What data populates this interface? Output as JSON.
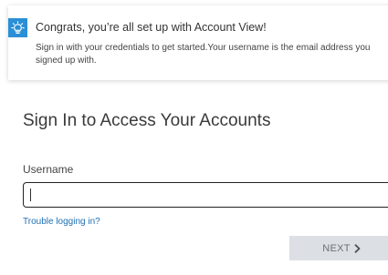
{
  "notice": {
    "icon": "lightbulb-icon",
    "title": "Congrats, you’re all set up with Account View!",
    "body": "Sign in with your credentials to get started.Your username is the email address you signed up with."
  },
  "signin": {
    "heading": "Sign In to Access Your Accounts",
    "username_label": "Username",
    "username_value": "",
    "trouble_link": "Trouble logging in?",
    "next_label": "NEXT",
    "next_icon": "chevron-right-icon"
  },
  "colors": {
    "accent": "#2a8fd6",
    "link": "#1f6fb2",
    "button_disabled_bg": "#dcdfe3",
    "button_disabled_text": "#6b7178"
  }
}
